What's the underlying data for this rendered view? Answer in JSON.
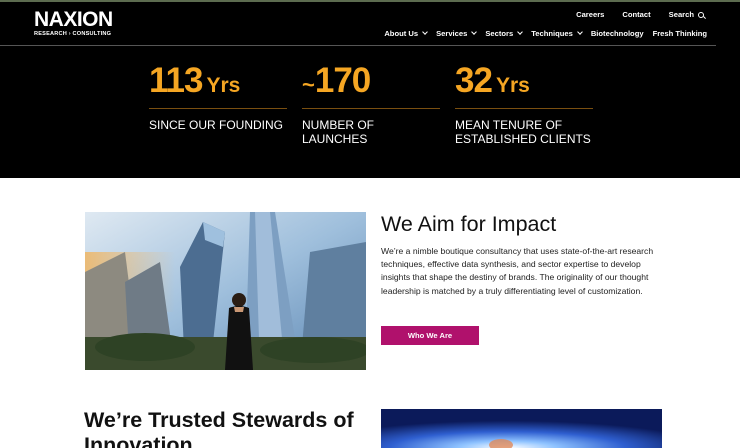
{
  "brand": {
    "logo_name": "NAXION",
    "logo_tagline": "RESEARCH › CONSULTING"
  },
  "utility_nav": {
    "careers": "Careers",
    "contact": "Contact",
    "search": "Search"
  },
  "main_nav": [
    {
      "label": "About Us",
      "has_dropdown": true
    },
    {
      "label": "Services",
      "has_dropdown": true
    },
    {
      "label": "Sectors",
      "has_dropdown": true
    },
    {
      "label": "Techniques",
      "has_dropdown": true
    },
    {
      "label": "Biotechnology",
      "has_dropdown": false
    },
    {
      "label": "Fresh Thinking",
      "has_dropdown": false
    }
  ],
  "stats": [
    {
      "prefix": "",
      "number": "113",
      "unit": "Yrs",
      "label": "SINCE OUR FOUNDING"
    },
    {
      "prefix": "~",
      "number": "170",
      "unit": "",
      "label": "NUMBER OF LAUNCHES"
    },
    {
      "prefix": "",
      "number": "32",
      "unit": "Yrs",
      "label": "MEAN TENURE OF ESTABLISHED CLIENTS"
    }
  ],
  "impact": {
    "title": "We Aim for Impact",
    "body": "We’re a nimble boutique consultancy that uses state-of-the-art research techniques, effective data synthesis, and sector expertise to develop insights that shape the destiny of brands. The originality of our thought leadership is matched by a truly differentiating level of customization.",
    "button_label": "Who We Are"
  },
  "stewards": {
    "title": "We’re Trusted Stewards of Innovation"
  },
  "colors": {
    "hero_bg": "#000000",
    "stat_accent": "#f5a623",
    "button_bg": "#b0116c",
    "text_dark": "#111111"
  }
}
